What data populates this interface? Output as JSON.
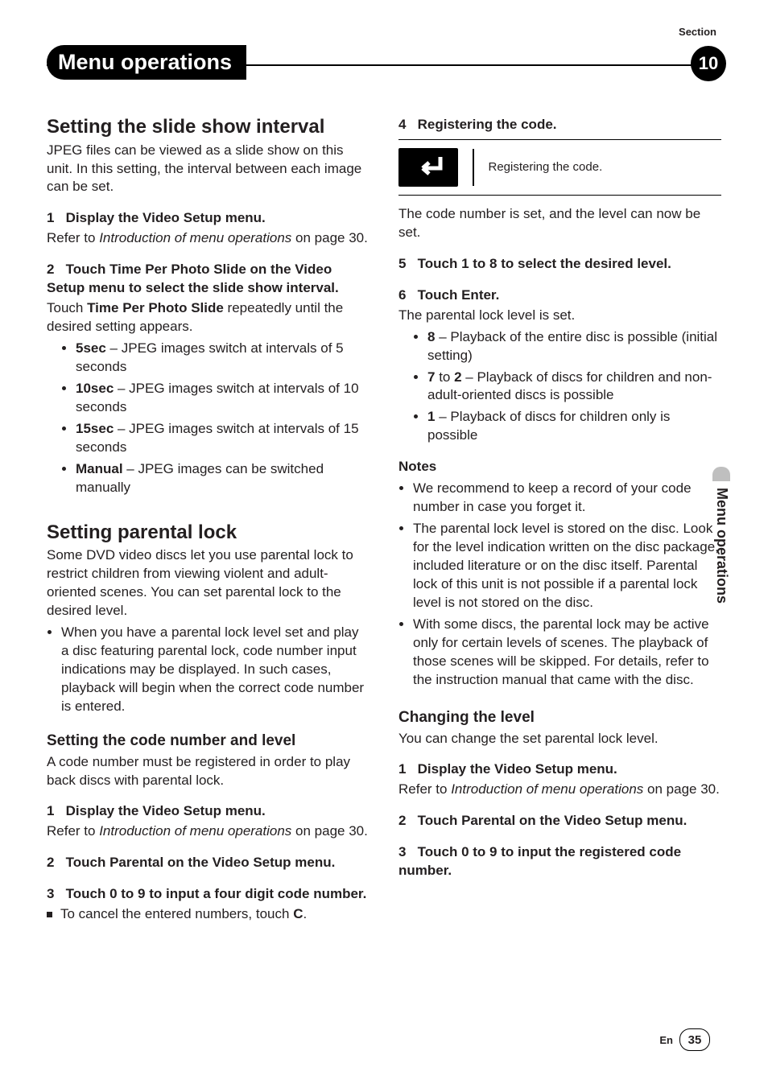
{
  "header": {
    "section_label": "Section",
    "title": "Menu operations",
    "section_number": "10"
  },
  "sidetab": {
    "label": "Menu operations"
  },
  "footer": {
    "lang": "En",
    "page": "35"
  },
  "left": {
    "h_slide": "Setting the slide show interval",
    "slide_intro": "JPEG files can be viewed as a slide show on this unit. In this setting, the interval between each image can be set.",
    "slide_step1_num": "1",
    "slide_step1": "Display the Video Setup menu.",
    "slide_ref1a": "Refer to ",
    "slide_ref1b": "Introduction of menu operations",
    "slide_ref1c": " on page 30.",
    "slide_step2_num": "2",
    "slide_step2": "Touch Time Per Photo Slide on the Video Setup menu to select the slide show interval.",
    "slide_touch_a": "Touch ",
    "slide_touch_b": "Time Per Photo Slide",
    "slide_touch_c": " repeatedly until the desired setting appears.",
    "opts": {
      "o1b": "5sec",
      "o1": " – JPEG images switch at intervals of 5 seconds",
      "o2b": "10sec",
      "o2": " – JPEG images switch at intervals of 10 seconds",
      "o3b": "15sec",
      "o3": " – JPEG images switch at intervals of 15 seconds",
      "o4b": "Manual",
      "o4": " – JPEG images can be switched manually"
    },
    "h_parent": "Setting parental lock",
    "parent_intro": "Some DVD video discs let you use parental lock to restrict children from viewing violent and adult-oriented scenes. You can set parental lock to the desired level.",
    "parent_note": "When you have a parental lock level set and play a disc featuring parental lock, code number input indications may be displayed. In such cases, playback will begin when the correct code number is entered.",
    "h_code": "Setting the code number and level",
    "code_intro": "A code number must be registered in order to play back discs with parental lock.",
    "code_step1_num": "1",
    "code_step1": "Display the Video Setup menu.",
    "code_ref1a": "Refer to ",
    "code_ref1b": "Introduction of menu operations",
    "code_ref1c": " on page 30.",
    "code_step2_num": "2",
    "code_step2": "Touch Parental on the Video Setup menu.",
    "code_step3_num": "3",
    "code_step3": "Touch 0 to 9 to input a four digit code number.",
    "cancel_a": "To cancel the entered numbers, touch ",
    "cancel_b": "C",
    "cancel_c": "."
  },
  "right": {
    "reg_num": "4",
    "reg_step": "Registering the code.",
    "fig_label": "Registering the code.",
    "reg_after": "The code number is set, and the level can now be set.",
    "lvl_num": "5",
    "lvl_step": "Touch 1 to 8 to select the desired level.",
    "ent_num": "6",
    "ent_step": "Touch Enter.",
    "ent_after": "The parental lock level is set.",
    "lvl_opts": {
      "a_b": "8",
      "a": " – Playback of the entire disc is possible (initial setting)",
      "b_b": "7",
      "b_mid": " to ",
      "b_b2": "2",
      "b": " – Playback of discs for children and non-adult-oriented discs is possible",
      "c_b": "1",
      "c": " – Playback of discs for children only is possible"
    },
    "notes_h": "Notes",
    "notes": {
      "n1": "We recommend to keep a record of your code number in case you forget it.",
      "n2": "The parental lock level is stored on the disc. Look for the level indication written on the disc package, included literature or on the disc itself. Parental lock of this unit is not possible if a parental lock level is not stored on the disc.",
      "n3": "With some discs, the parental lock may be active only for certain levels of scenes. The playback of those scenes will be skipped. For details, refer to the instruction manual that came with the disc."
    },
    "h_change": "Changing the level",
    "change_intro": "You can change the set parental lock level.",
    "ch_step1_num": "1",
    "ch_step1": "Display the Video Setup menu.",
    "ch_ref1a": "Refer to ",
    "ch_ref1b": "Introduction of menu operations",
    "ch_ref1c": " on page 30.",
    "ch_step2_num": "2",
    "ch_step2": "Touch Parental on the Video Setup menu.",
    "ch_step3_num": "3",
    "ch_step3": "Touch 0 to 9 to input the registered code number."
  }
}
